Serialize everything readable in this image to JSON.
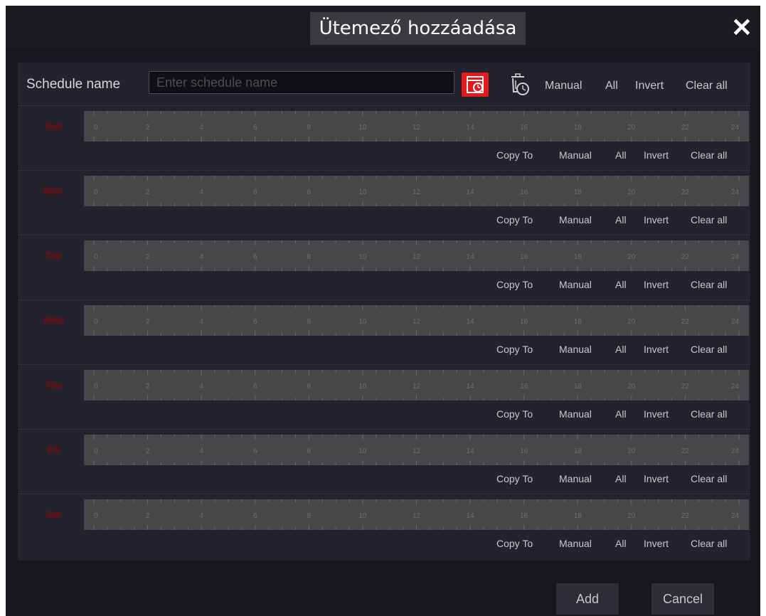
{
  "dialog": {
    "title": "Ütemező hozzáadása",
    "close": "✕"
  },
  "header": {
    "schedule_label": "Schedule name",
    "schedule_placeholder": "Enter schedule name",
    "links": [
      "Manual",
      "All",
      "Invert",
      "Clear all"
    ]
  },
  "days": [
    {
      "name": "Sun"
    },
    {
      "name": "Mon"
    },
    {
      "name": "Tue"
    },
    {
      "name": "Wed"
    },
    {
      "name": "Thu"
    },
    {
      "name": "Fri"
    },
    {
      "name": "Sat"
    }
  ],
  "day_links": [
    "Copy To",
    "Manual",
    "All",
    "Invert",
    "Clear all"
  ],
  "ticks": [
    "0",
    "2",
    "4",
    "6",
    "8",
    "10",
    "12",
    "14",
    "16",
    "18",
    "20",
    "22",
    "24"
  ],
  "footer": {
    "add": "Add",
    "cancel": "Cancel"
  },
  "colors": {
    "accent": "#e4191c",
    "day_label": "#b00000"
  }
}
